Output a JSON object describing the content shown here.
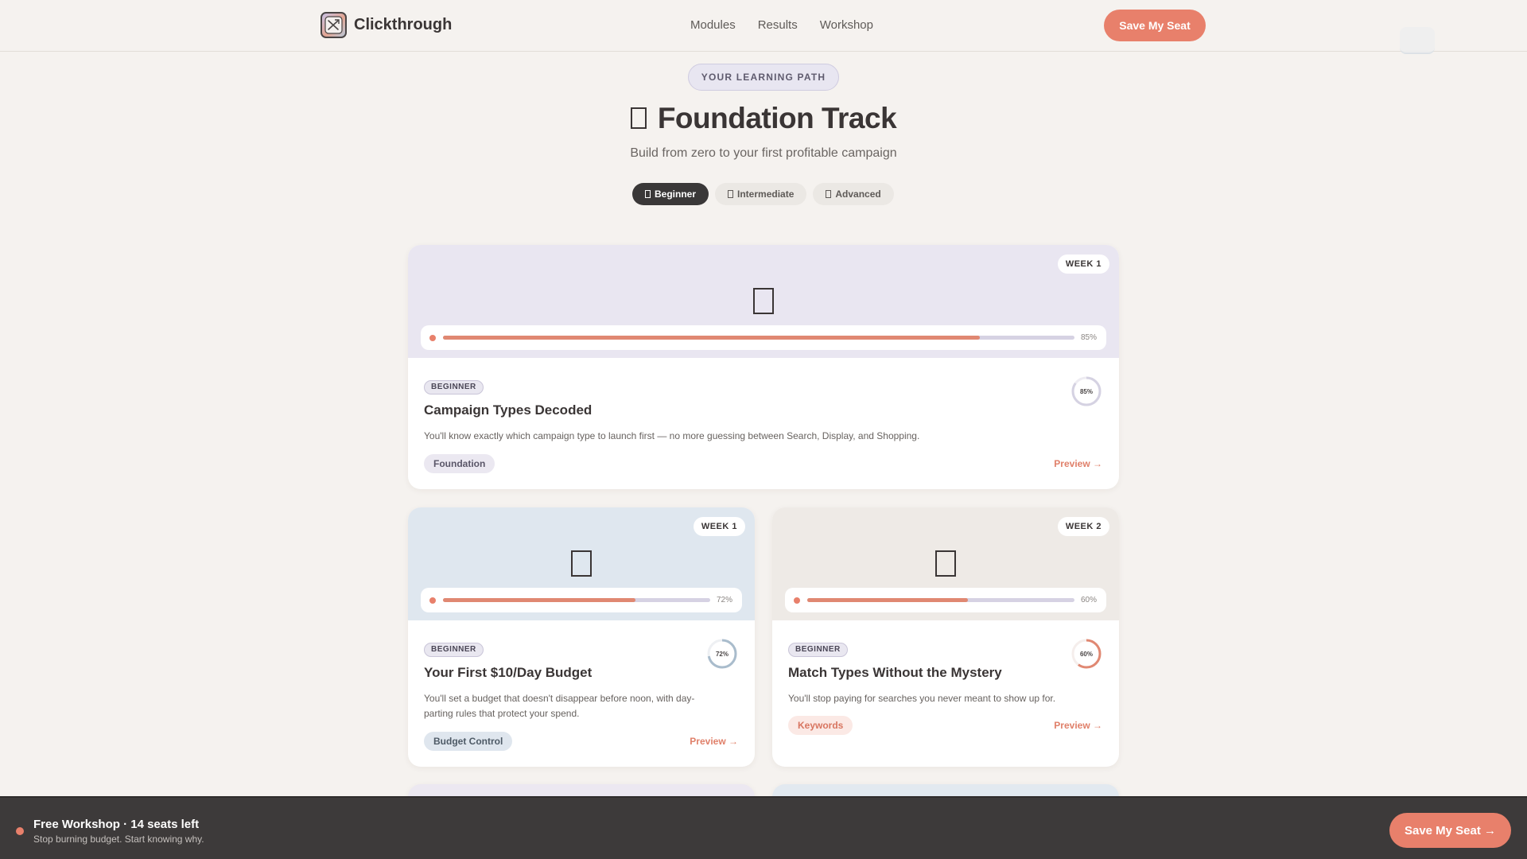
{
  "header": {
    "brand": "Clickthrough",
    "nav": [
      "Modules",
      "Results",
      "Workshop"
    ],
    "cta": "Save My Seat"
  },
  "hero": {
    "eyebrow": "YOUR LEARNING PATH",
    "title": "Foundation Track",
    "subtitle": "Build from zero to your first profitable campaign",
    "levels": [
      {
        "label": "Beginner",
        "active": true
      },
      {
        "label": "Intermediate",
        "active": false
      },
      {
        "label": "Advanced",
        "active": false
      }
    ]
  },
  "cards": [
    {
      "week": "WEEK 1",
      "progress": 85,
      "progress_label": "85%",
      "level": "BEGINNER",
      "title": "Campaign Types Decoded",
      "description": "You'll know exactly which campaign type to launch first — no more guessing between Search, Display, and Shopping.",
      "tag": "Foundation",
      "preview": "Preview →",
      "top_color": "#e9e6f1",
      "ring_color": "#d5d2e2",
      "tag_bg": "#ebe8f1",
      "tag_color": "#5a5668"
    },
    {
      "week": "WEEK 1",
      "progress": 72,
      "progress_label": "72%",
      "level": "BEGINNER",
      "title": "Your First $10/Day Budget",
      "description": "You'll set a budget that doesn't disappear before noon, with day-parting rules that protect your spend.",
      "tag": "Budget Control",
      "preview": "Preview →",
      "top_color": "#dfe7ef",
      "ring_color": "#a9bccc",
      "tag_bg": "#dfe6ee",
      "tag_color": "#4e5a66"
    },
    {
      "week": "WEEK 2",
      "progress": 60,
      "progress_label": "60%",
      "level": "BEGINNER",
      "title": "Match Types Without the Mystery",
      "description": "You'll stop paying for searches you never meant to show up for.",
      "tag": "Keywords",
      "preview": "Preview →",
      "top_color": "#eeeae6",
      "ring_color": "#e08872",
      "tag_bg": "#fbe9e5",
      "tag_color": "#d87560"
    }
  ],
  "bottom_bar": {
    "title": "Free Workshop · 14 seats left",
    "subtitle": "Stop burning budget. Start knowing why.",
    "cta": "Save My Seat →"
  },
  "colors": {
    "accent": "#e8806b",
    "background": "#f5f2ef",
    "dark": "#3d3a3a"
  }
}
